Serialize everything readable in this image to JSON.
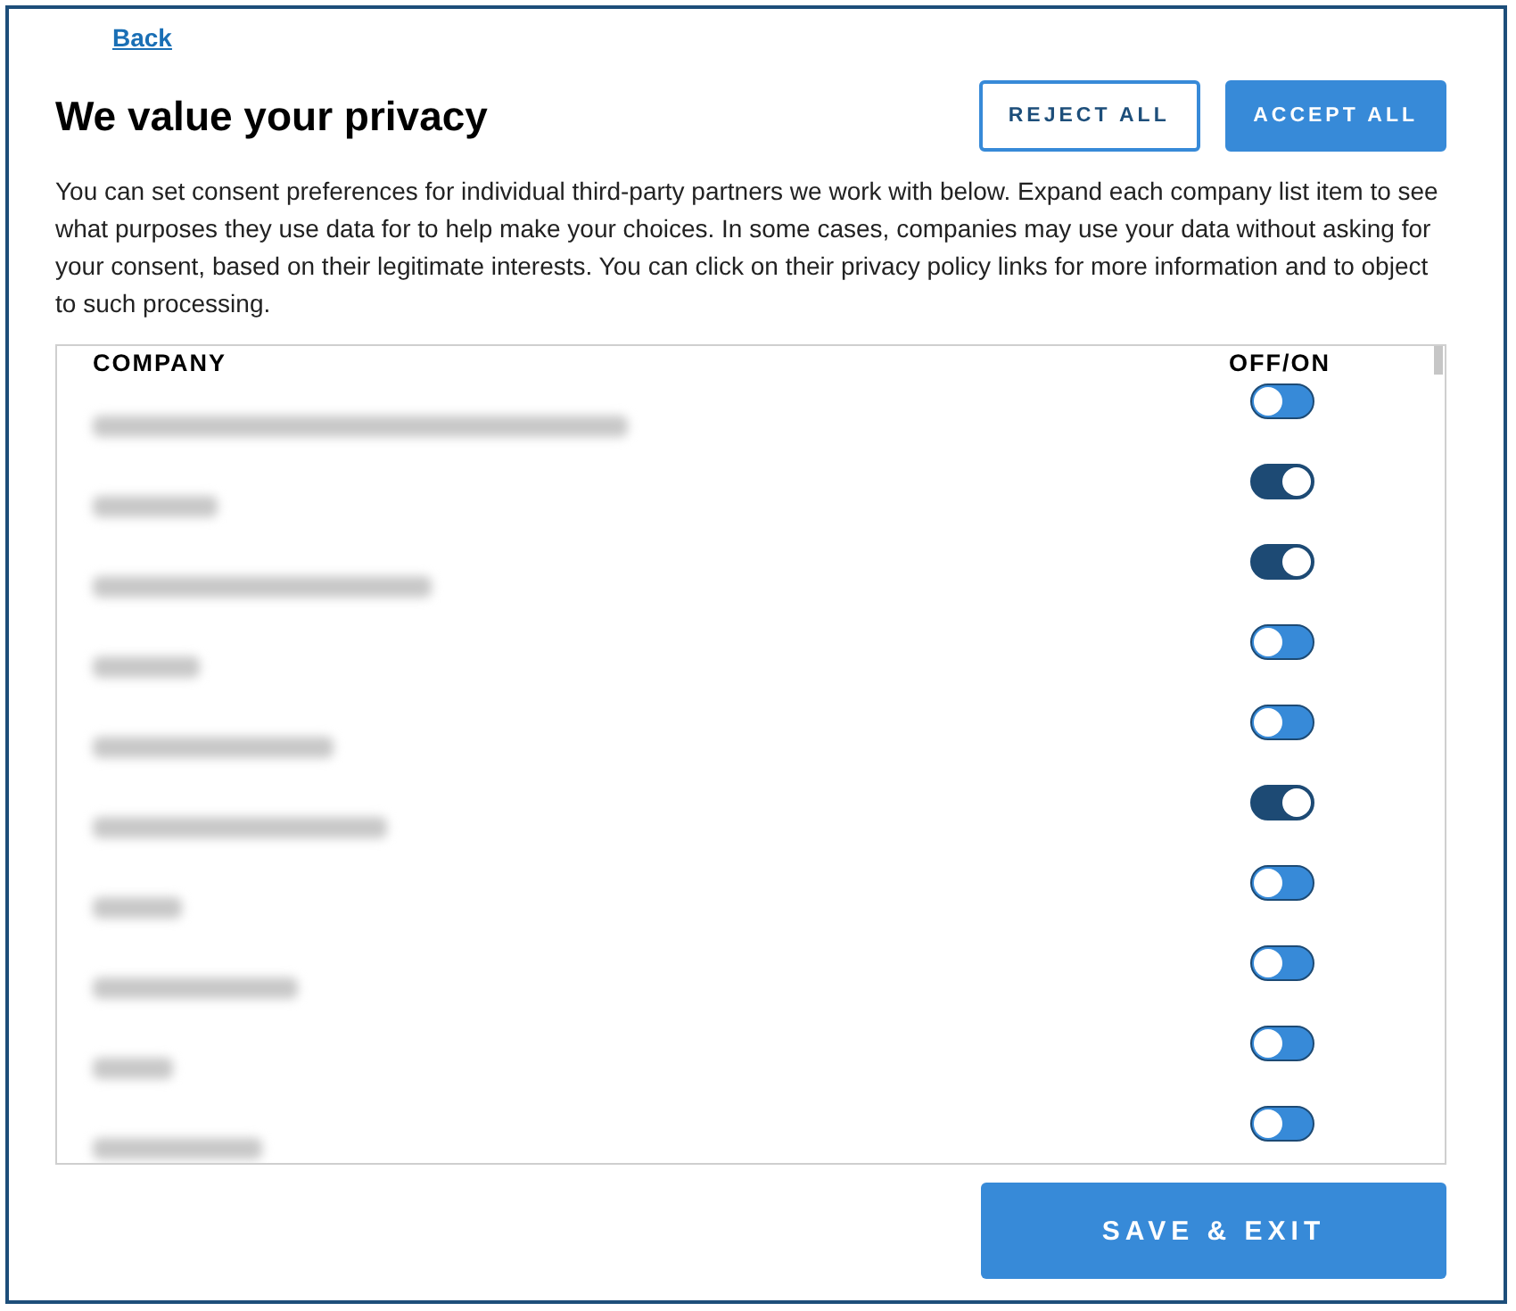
{
  "back_link": "Back",
  "title": "We value your privacy",
  "buttons": {
    "reject": "REJECT ALL",
    "accept": "ACCEPT ALL",
    "save": "SAVE & EXIT"
  },
  "description": "You can set consent preferences for individual third-party partners we work with below. Expand each company list item to see what purposes they use data for to help make your choices. In some cases, companies may use your data without asking for your consent, based on their legitimate interests. You can click on their privacy policy links for more information and to object to such processing.",
  "table": {
    "columns": [
      "COMPANY",
      "OFF/ON"
    ],
    "rows": [
      {
        "on": false
      },
      {
        "on": true
      },
      {
        "on": true
      },
      {
        "on": false
      },
      {
        "on": false
      },
      {
        "on": true
      },
      {
        "on": false
      },
      {
        "on": false
      },
      {
        "on": false
      },
      {
        "on": false
      }
    ]
  }
}
